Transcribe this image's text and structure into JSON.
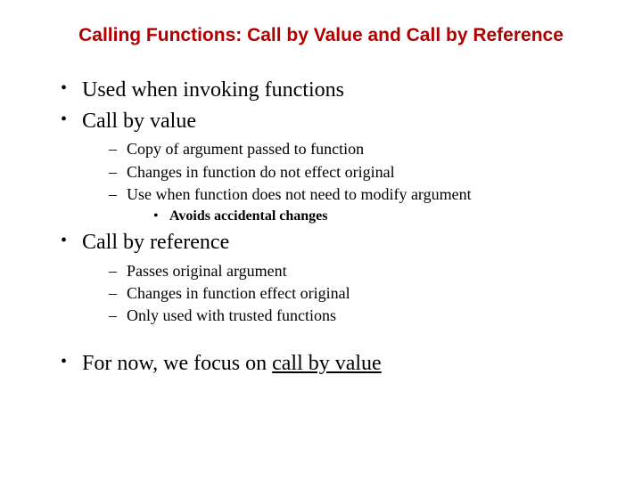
{
  "title": "Calling Functions: Call by Value and Call by Reference",
  "b1": "Used when invoking functions",
  "b2": "Call by value",
  "b2s": {
    "a": "Copy of argument passed to function",
    "b": "Changes in function do not effect original",
    "c": "Use when function does not need to modify argument",
    "c1": "Avoids accidental changes"
  },
  "b3": "Call by reference",
  "b3s": {
    "a": "Passes original argument",
    "b": "Changes in function effect original",
    "c": "Only used with trusted functions"
  },
  "b4_pre": "For now, we focus on ",
  "b4_u": "call by value"
}
